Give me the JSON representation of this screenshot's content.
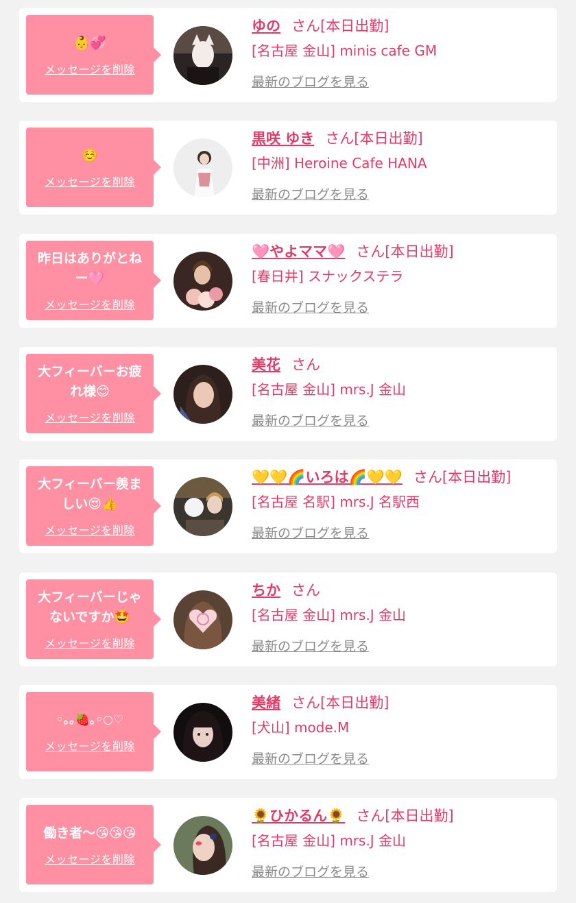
{
  "delete_label": "メッセージを削除",
  "blog_label": "最新のブログを見る",
  "cards": [
    {
      "message": "👶💞",
      "name": "ゆの",
      "suffix": "さん[本日出勤]",
      "shop": "[名古屋 金山] minis cafe GM"
    },
    {
      "message": "☺️",
      "name": "黒咲 ゆき",
      "suffix": "さん[本日出勤]",
      "shop": "[中洲] Heroine Cafe HANA"
    },
    {
      "message": "昨日はありがとねー🩷",
      "name": "🩷やよママ🩷",
      "suffix": "さん[本日出勤]",
      "shop": "[春日井] スナックステラ"
    },
    {
      "message": "大フィーバーお疲れ様😊",
      "name": "美花",
      "suffix": "さん",
      "shop": "[名古屋 金山] mrs.J 金山"
    },
    {
      "message": "大フィーバー羨ましい😍👍",
      "name": "💛💛🌈いろは🌈💛💛",
      "suffix": "さん[本日出勤]",
      "shop": "[名古屋 名駅] mrs.J 名駅西"
    },
    {
      "message": "大フィーバーじゃないですか🤩",
      "name": "ちか",
      "suffix": "さん",
      "shop": "[名古屋 金山] mrs.J 金山"
    },
    {
      "message": "◦｡｡🍓｡◦○♡",
      "name": "美緒",
      "suffix": "さん[本日出勤]",
      "shop": "[犬山] mode.M"
    },
    {
      "message": "働き者〜😘😘😘",
      "name": "🌻ひかるん🌻",
      "suffix": "さん[本日出勤]",
      "shop": "[名古屋 金山] mrs.J 金山"
    }
  ],
  "colors": {
    "bubble": "#ff8fa3",
    "accent": "#e23b67",
    "link_gray": "#8a8a8a",
    "background": "#f2f2f2"
  }
}
